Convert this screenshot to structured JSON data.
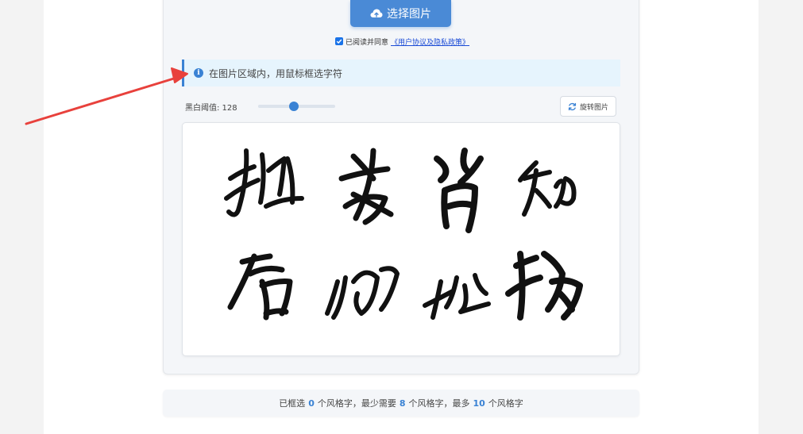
{
  "upload": {
    "label": "选择图片",
    "icon": "cloud-upload-icon"
  },
  "agreement": {
    "checked": true,
    "text": "已阅读并同意",
    "link": "《用户协议及隐私政策》"
  },
  "notice": {
    "icon": "info-icon",
    "text": "在图片区域内，用鼠标框选字符"
  },
  "threshold": {
    "label": "黑白阈值: 128",
    "value": 128,
    "min": 0,
    "max": 255
  },
  "rotate": {
    "label": "旋转图片",
    "icon": "rotate-icon"
  },
  "image": {
    "description_rows": [
      [
        "拙",
        "者",
        "省",
        "知"
      ],
      [
        "启",
        "何",
        "此",
        "物"
      ]
    ]
  },
  "status": {
    "prefix": "已框选",
    "selected": "0",
    "text1": "个风格字，最少需要",
    "min": "8",
    "text2": "个风格字，最多",
    "max": "10",
    "text3": "个风格字"
  },
  "colors": {
    "accent": "#3a82d4",
    "button": "#4a8ad6",
    "annotation_arrow": "#e8413c"
  }
}
